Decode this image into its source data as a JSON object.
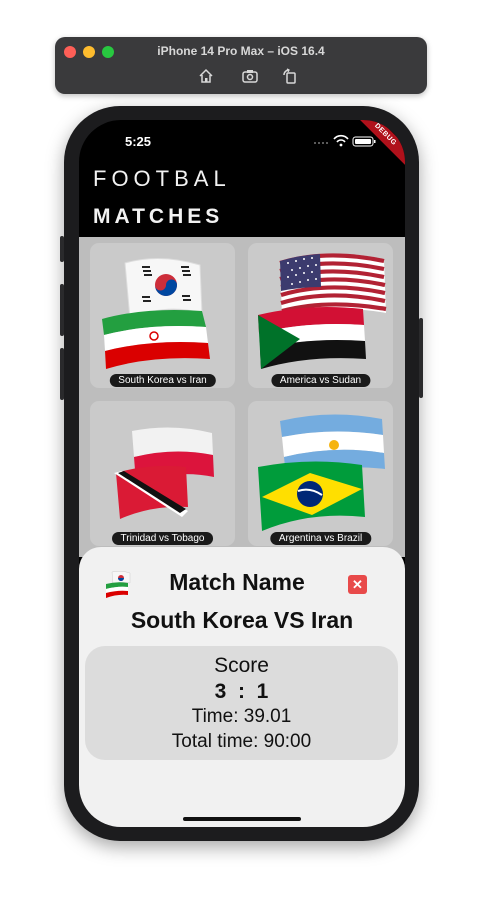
{
  "simulator": {
    "title": "iPhone 14 Pro Max – iOS 16.4",
    "tools": [
      "home-icon",
      "screenshot-icon",
      "rotate-icon"
    ]
  },
  "status_bar": {
    "time": "5:25",
    "debug_label": "DEBUG"
  },
  "header": {
    "title_line1": "FOOTBAL",
    "title_line2": "MATCHES"
  },
  "matches": [
    {
      "label": "South Korea vs Iran",
      "flags": [
        "south-korea-flag",
        "iran-flag"
      ]
    },
    {
      "label": "America vs Sudan",
      "flags": [
        "usa-flag",
        "sudan-flag"
      ]
    },
    {
      "label": "Trinidad vs Tobago",
      "flags": [
        "poland-style-flag",
        "trinidad-tobago-flag"
      ]
    },
    {
      "label": "Argentina vs Brazil",
      "flags": [
        "argentina-flag",
        "brazil-flag"
      ]
    }
  ],
  "detail_sheet": {
    "heading": "Match Name",
    "close_label": "✕",
    "match_title": "South Korea VS Iran",
    "score_label": "Score",
    "score_value": "3  :  1",
    "time_text": "Time: 39.01",
    "total_time_text": "Total time: 90:00"
  },
  "colors": {
    "close_button": "#e84a4a",
    "screen_background": "#000000",
    "sheet_background": "#f1f1f1",
    "score_box": "#dcdcdc"
  }
}
